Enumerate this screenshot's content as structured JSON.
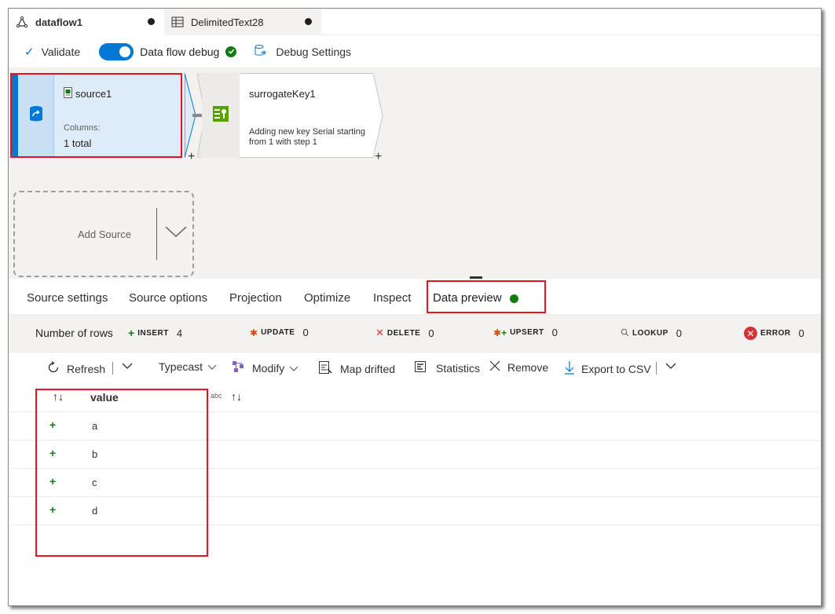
{
  "tabs": [
    {
      "label": "dataflow1",
      "icon": "dataflow-icon",
      "unsaved": true
    },
    {
      "label": "DelimitedText28",
      "icon": "table-icon",
      "unsaved": true
    }
  ],
  "toolbar": {
    "validate": "Validate",
    "debug_label": "Data flow debug",
    "debug_on": true,
    "debug_settings": "Debug Settings"
  },
  "canvas": {
    "source_node": {
      "title": "source1",
      "columns_label": "Columns:",
      "columns_value": "1 total"
    },
    "sk_node": {
      "title": "surrogateKey1",
      "description": "Adding new key Serial starting from 1 with step 1"
    },
    "add_source": "Add Source",
    "plus": "+"
  },
  "config_tabs": [
    "Source settings",
    "Source options",
    "Projection",
    "Optimize",
    "Inspect",
    "Data preview"
  ],
  "stats": {
    "rows_label": "Number of rows",
    "insert": {
      "label": "INSERT",
      "value": "4"
    },
    "update": {
      "label": "UPDATE",
      "value": "0"
    },
    "delete": {
      "label": "DELETE",
      "value": "0"
    },
    "upsert": {
      "label": "UPSERT",
      "value": "0"
    },
    "lookup": {
      "label": "LOOKUP",
      "value": "0"
    },
    "error": {
      "label": "ERROR",
      "value": "0"
    }
  },
  "actions": {
    "refresh": "Refresh",
    "typecast": "Typecast",
    "modify": "Modify",
    "map_drifted": "Map drifted",
    "statistics": "Statistics",
    "remove": "Remove",
    "export": "Export to CSV"
  },
  "grid": {
    "column": "value",
    "column_type": "abc",
    "rows": [
      "a",
      "b",
      "c",
      "d"
    ]
  },
  "colors": {
    "accent": "#0078d4",
    "success": "#107c10",
    "error": "#d13438",
    "highlight": "#e81123"
  }
}
